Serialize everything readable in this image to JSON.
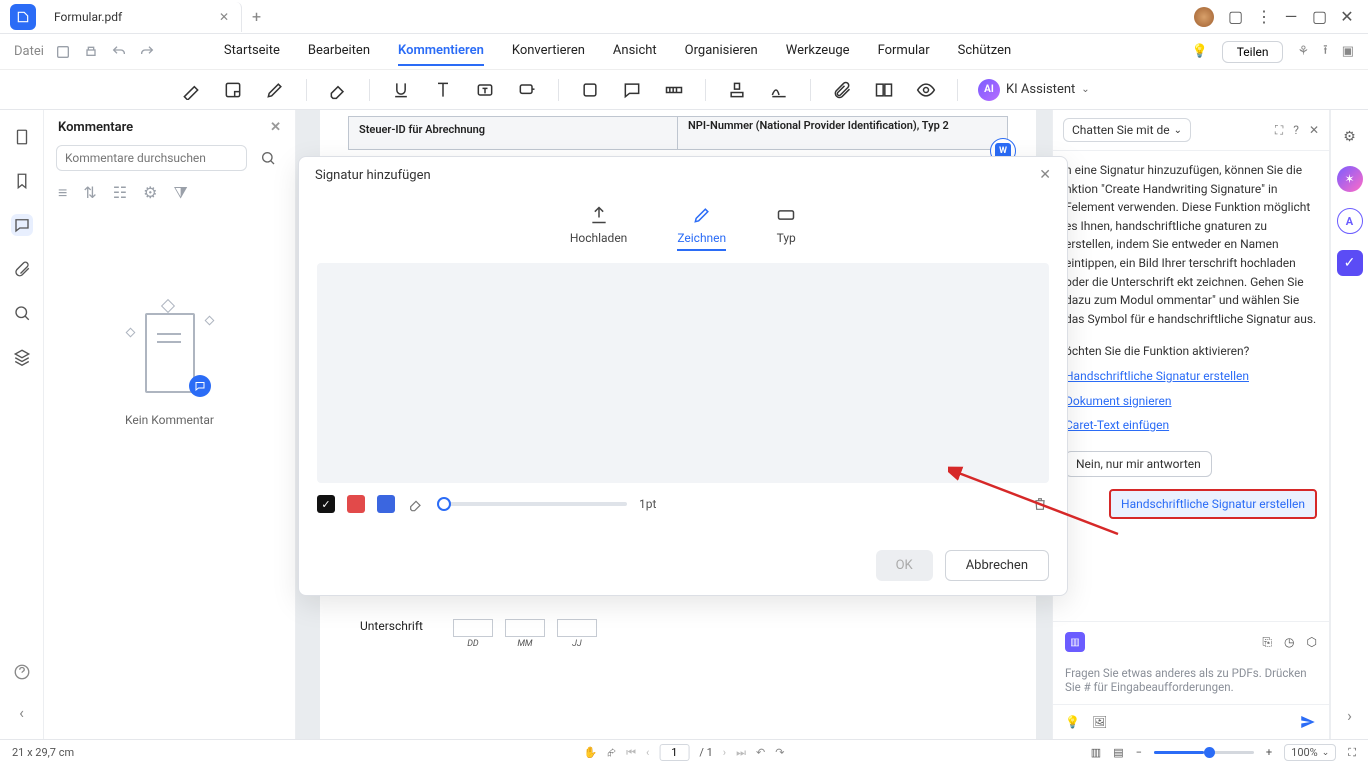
{
  "titlebar": {
    "tab_title": "Formular.pdf"
  },
  "menubar": {
    "file": "Datei",
    "items": [
      "Startseite",
      "Bearbeiten",
      "Kommentieren",
      "Konvertieren",
      "Ansicht",
      "Organisieren",
      "Werkzeuge",
      "Formular",
      "Schützen"
    ],
    "active_index": 2,
    "share": "Teilen"
  },
  "ai_assistant_label": "KI Assistent",
  "comments": {
    "title": "Kommentare",
    "search_placeholder": "Kommentare durchsuchen",
    "empty": "Kein Kommentar"
  },
  "form": {
    "left_cell": "Steuer-ID für Abrechnung",
    "right_cell": "NPI-Nummer (National Provider Identification), Typ 2",
    "signature_label": "Unterschrift",
    "date_dd": "DD",
    "date_mm": "MM",
    "date_yy": "JJ"
  },
  "modal": {
    "title": "Signatur hinzufügen",
    "tabs": {
      "upload": "Hochladen",
      "draw": "Zeichnen",
      "type": "Typ"
    },
    "active_tab": "draw",
    "stroke_value": "1pt",
    "ok": "OK",
    "cancel": "Abbrechen",
    "stroke_colors": {
      "black": "#111111",
      "red": "#e24a4a",
      "blue": "#3b66e0"
    }
  },
  "ai_panel": {
    "select_label": "Chatten Sie mit de",
    "body_text": "n eine Signatur hinzuzufügen, können Sie die nktion \"Create Handwriting Signature\" in Felement verwenden. Diese Funktion möglicht es Ihnen, handschriftliche gnaturen zu erstellen, indem Sie entweder en Namen eintippen, ein Bild Ihrer terschrift hochladen oder die Unterschrift ekt zeichnen. Gehen Sie dazu zum Modul ommentar\" und wählen Sie das Symbol für e handschriftliche Signatur aus.",
    "question": "öchten Sie die Funktion aktivieren?",
    "link1": "Handschriftliche Signatur erstellen",
    "link2": "Dokument signieren",
    "link3": "Caret-Text einfügen",
    "no_button": "Nein, nur mir antworten",
    "chip": "Handschriftliche Signatur erstellen",
    "prompt_hint": "Fragen Sie etwas anderes als zu PDFs. Drücken Sie # für Eingabeaufforderungen."
  },
  "statusbar": {
    "dimensions": "21 x 29,7 cm",
    "page_current": "1",
    "page_total": "/ 1",
    "zoom": "100%"
  }
}
